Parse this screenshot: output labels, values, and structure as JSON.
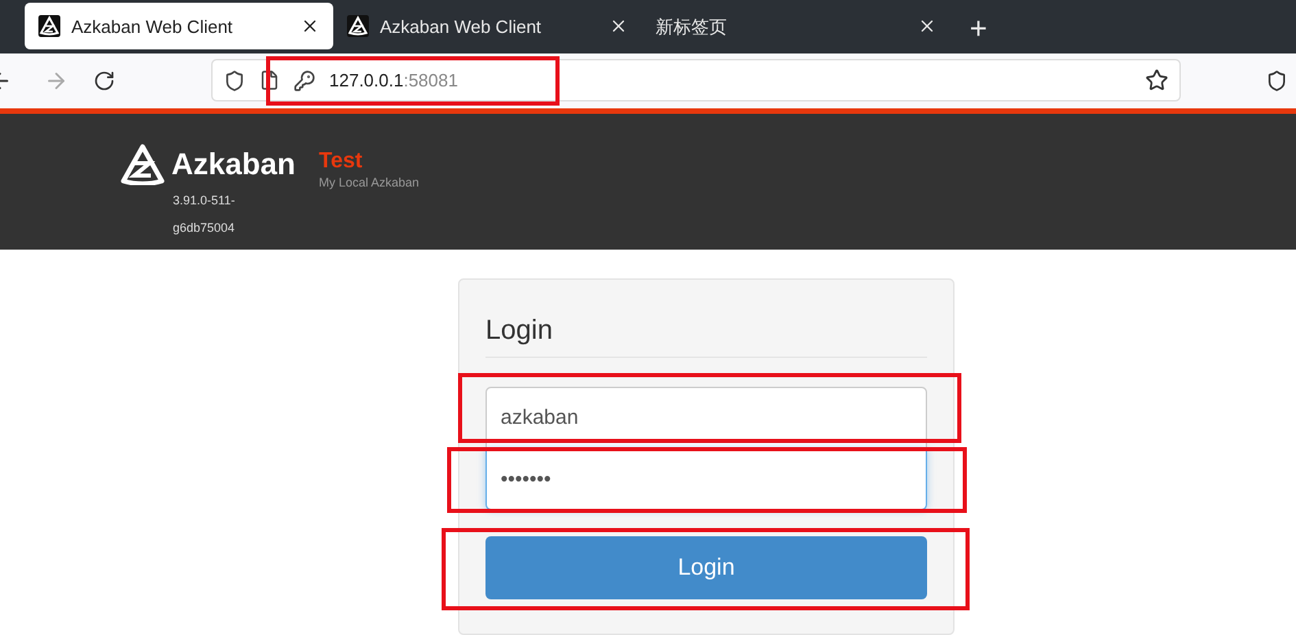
{
  "browser": {
    "tabs": [
      {
        "title": "Azkaban Web Client",
        "selected": true,
        "has_icon": true
      },
      {
        "title": "Azkaban Web Client",
        "selected": false,
        "has_icon": true
      },
      {
        "title": "新标签页",
        "selected": false,
        "has_icon": false
      }
    ],
    "new_tab": "+",
    "forward_disabled": true,
    "address": {
      "host": "127.0.0.1",
      "port": ":58081",
      "highlighted": true
    }
  },
  "header": {
    "brand": "Azkaban",
    "version": "3.91.0-511-g6db75004",
    "env_name": "Test",
    "env_description": "My Local Azkaban"
  },
  "login": {
    "title": "Login",
    "username": {
      "value": "azkaban",
      "highlighted": true
    },
    "password": {
      "value": "•••••••",
      "focused": true,
      "highlighted": true
    },
    "button": {
      "label": "Login",
      "highlighted": true
    }
  }
}
